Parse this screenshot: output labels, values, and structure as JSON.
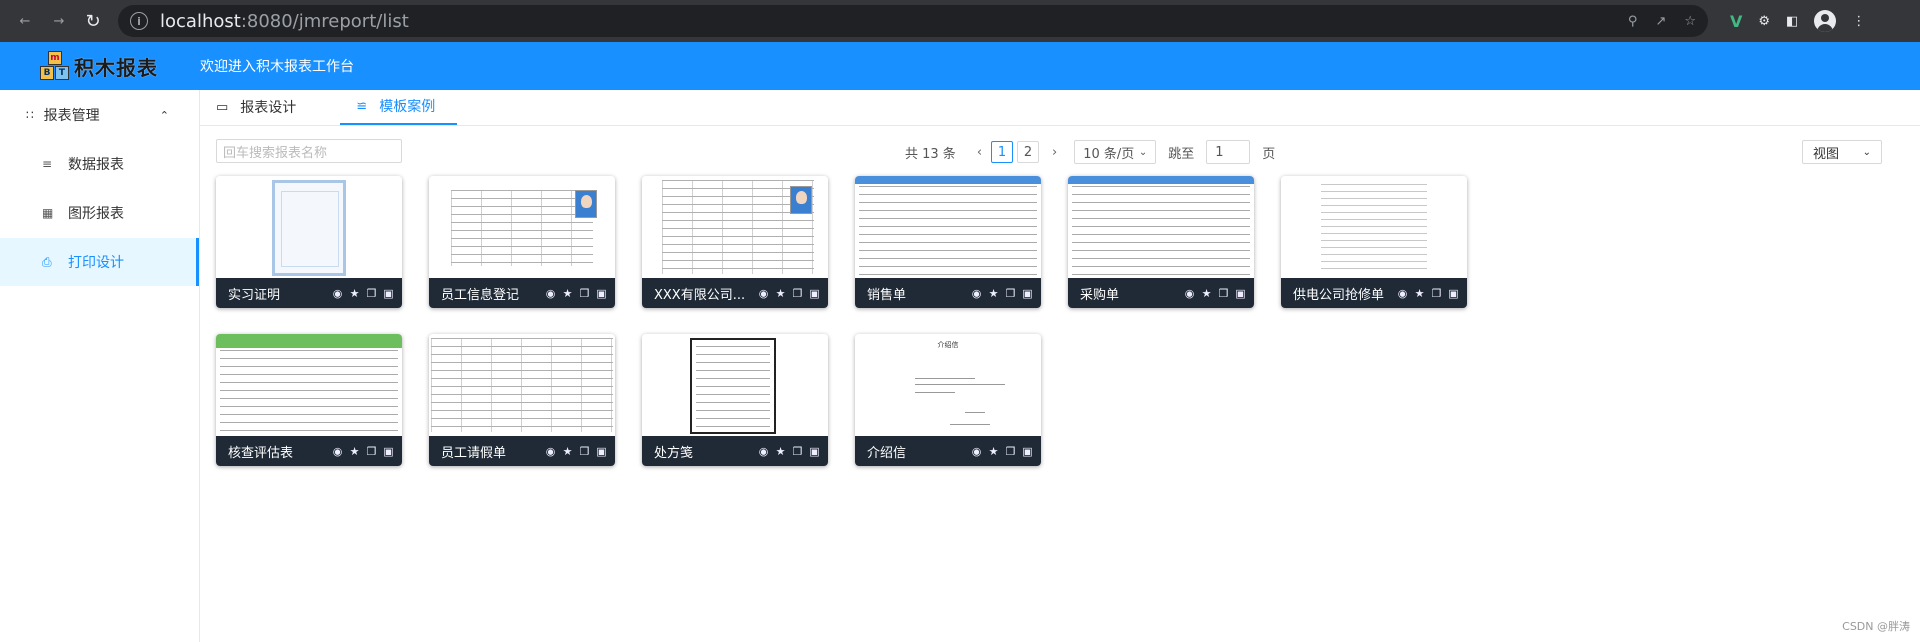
{
  "browser": {
    "url_host": "localhost",
    "url_path": ":8080/jmreport/list"
  },
  "header": {
    "logo_text": "积木报表",
    "logo_letters": [
      "m",
      "B",
      "T"
    ],
    "welcome": "欢迎进入积木报表工作台"
  },
  "sidebar": {
    "group_label": "报表管理",
    "items": [
      {
        "label": "数据报表",
        "icon": "list-icon"
      },
      {
        "label": "图形报表",
        "icon": "chart-icon"
      },
      {
        "label": "打印设计",
        "icon": "printer-icon",
        "active": true
      }
    ]
  },
  "tabs": [
    {
      "label": "报表设计",
      "icon": "monitor-icon"
    },
    {
      "label": "模板案例",
      "icon": "sliders-icon",
      "active": true
    }
  ],
  "toolbar": {
    "search_placeholder": "回车搜索报表名称",
    "total_text": "共 13 条",
    "pages": [
      "1",
      "2"
    ],
    "current_page": "1",
    "page_size": "10 条/页",
    "jump_label": "跳至",
    "jump_value": "1",
    "page_suffix": "页",
    "view_label": "视图"
  },
  "cards": [
    {
      "name": "实习证明",
      "thumb": "certificate"
    },
    {
      "name": "员工信息登记",
      "thumb": "form-photo"
    },
    {
      "name": "XXX有限公司...",
      "thumb": "form-photo-2"
    },
    {
      "name": "销售单",
      "thumb": "blue-table"
    },
    {
      "name": "采购单",
      "thumb": "blue-table"
    },
    {
      "name": "供电公司抢修单",
      "thumb": "plain-form"
    },
    {
      "name": "核查评估表",
      "thumb": "green-table"
    },
    {
      "name": "员工请假单",
      "thumb": "leave-form"
    },
    {
      "name": "处方笺",
      "thumb": "prescription"
    },
    {
      "name": "介绍信",
      "thumb": "letter"
    }
  ],
  "letter_title": "介绍信",
  "watermark": "CSDN @胖涛"
}
